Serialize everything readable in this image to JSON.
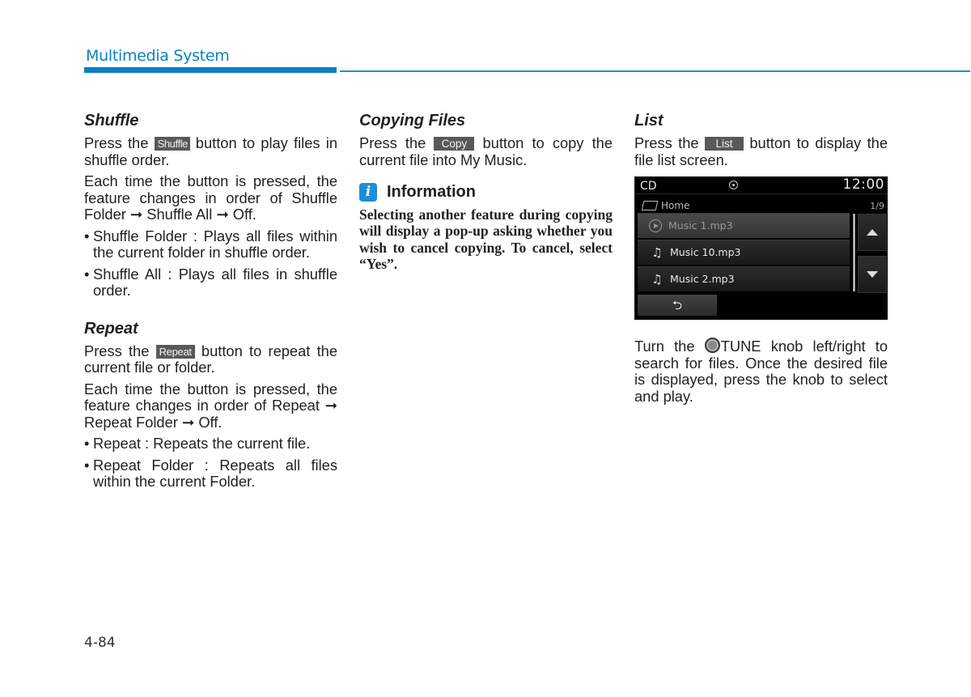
{
  "header": {
    "title": "Multimedia System",
    "accent_color": "#0b7fc4"
  },
  "shuffle": {
    "heading": "Shuffle",
    "p1_before": "Press the ",
    "button": "Shuffle",
    "p1_after": " button to play files in shuffle order.",
    "p2": "Each time the button is pressed, the feature changes in order of Shuffle Folder ➞ Shuffle All ➞ Off.",
    "bullets": [
      "Shuffle Folder : Plays all files within the current folder in shuffle order.",
      "Shuffle All : Plays all files in shuffle order."
    ]
  },
  "repeat": {
    "heading": "Repeat",
    "p1_before": "Press the ",
    "button": "Repeat",
    "p1_after": " button to repeat the current file or folder.",
    "p2": "Each time the button is pressed, the feature changes in order of Repeat ➞ Repeat Folder ➞ Off.",
    "bullets": [
      "Repeat : Repeats the current file.",
      "Repeat Folder : Repeats all files within the current Folder."
    ]
  },
  "copying": {
    "heading": "Copying Files",
    "p1_before": "Press the ",
    "button": "Copy",
    "p1_after": " button to copy the current file into My Music."
  },
  "information": {
    "icon": "i",
    "title": "Information",
    "body": "Selecting another feature during copying will display a pop-up asking whether you wish to cancel copying. To cancel, select “Yes”.",
    "icon_color": "#1c8fd8"
  },
  "list": {
    "heading": "List",
    "p1_before": "Press the ",
    "button": "List",
    "p1_after": " button to display the file list screen.",
    "tune_before": "Turn the ",
    "tune_after": "TUNE knob left/right to search for files. Once the desired file is displayed, press the knob to select and play."
  },
  "screen": {
    "source": "CD",
    "time": "12:00",
    "folder": "Home",
    "count": "1/9",
    "files": [
      {
        "name": "Music 1.mp3",
        "icon": "play-icon",
        "active": true
      },
      {
        "name": "Music 10.mp3",
        "icon": "music-note-icon",
        "active": false
      },
      {
        "name": "Music 2.mp3",
        "icon": "music-note-icon",
        "active": false
      }
    ],
    "back_glyph": "⮌"
  },
  "footer": {
    "page_number": "4-84"
  }
}
